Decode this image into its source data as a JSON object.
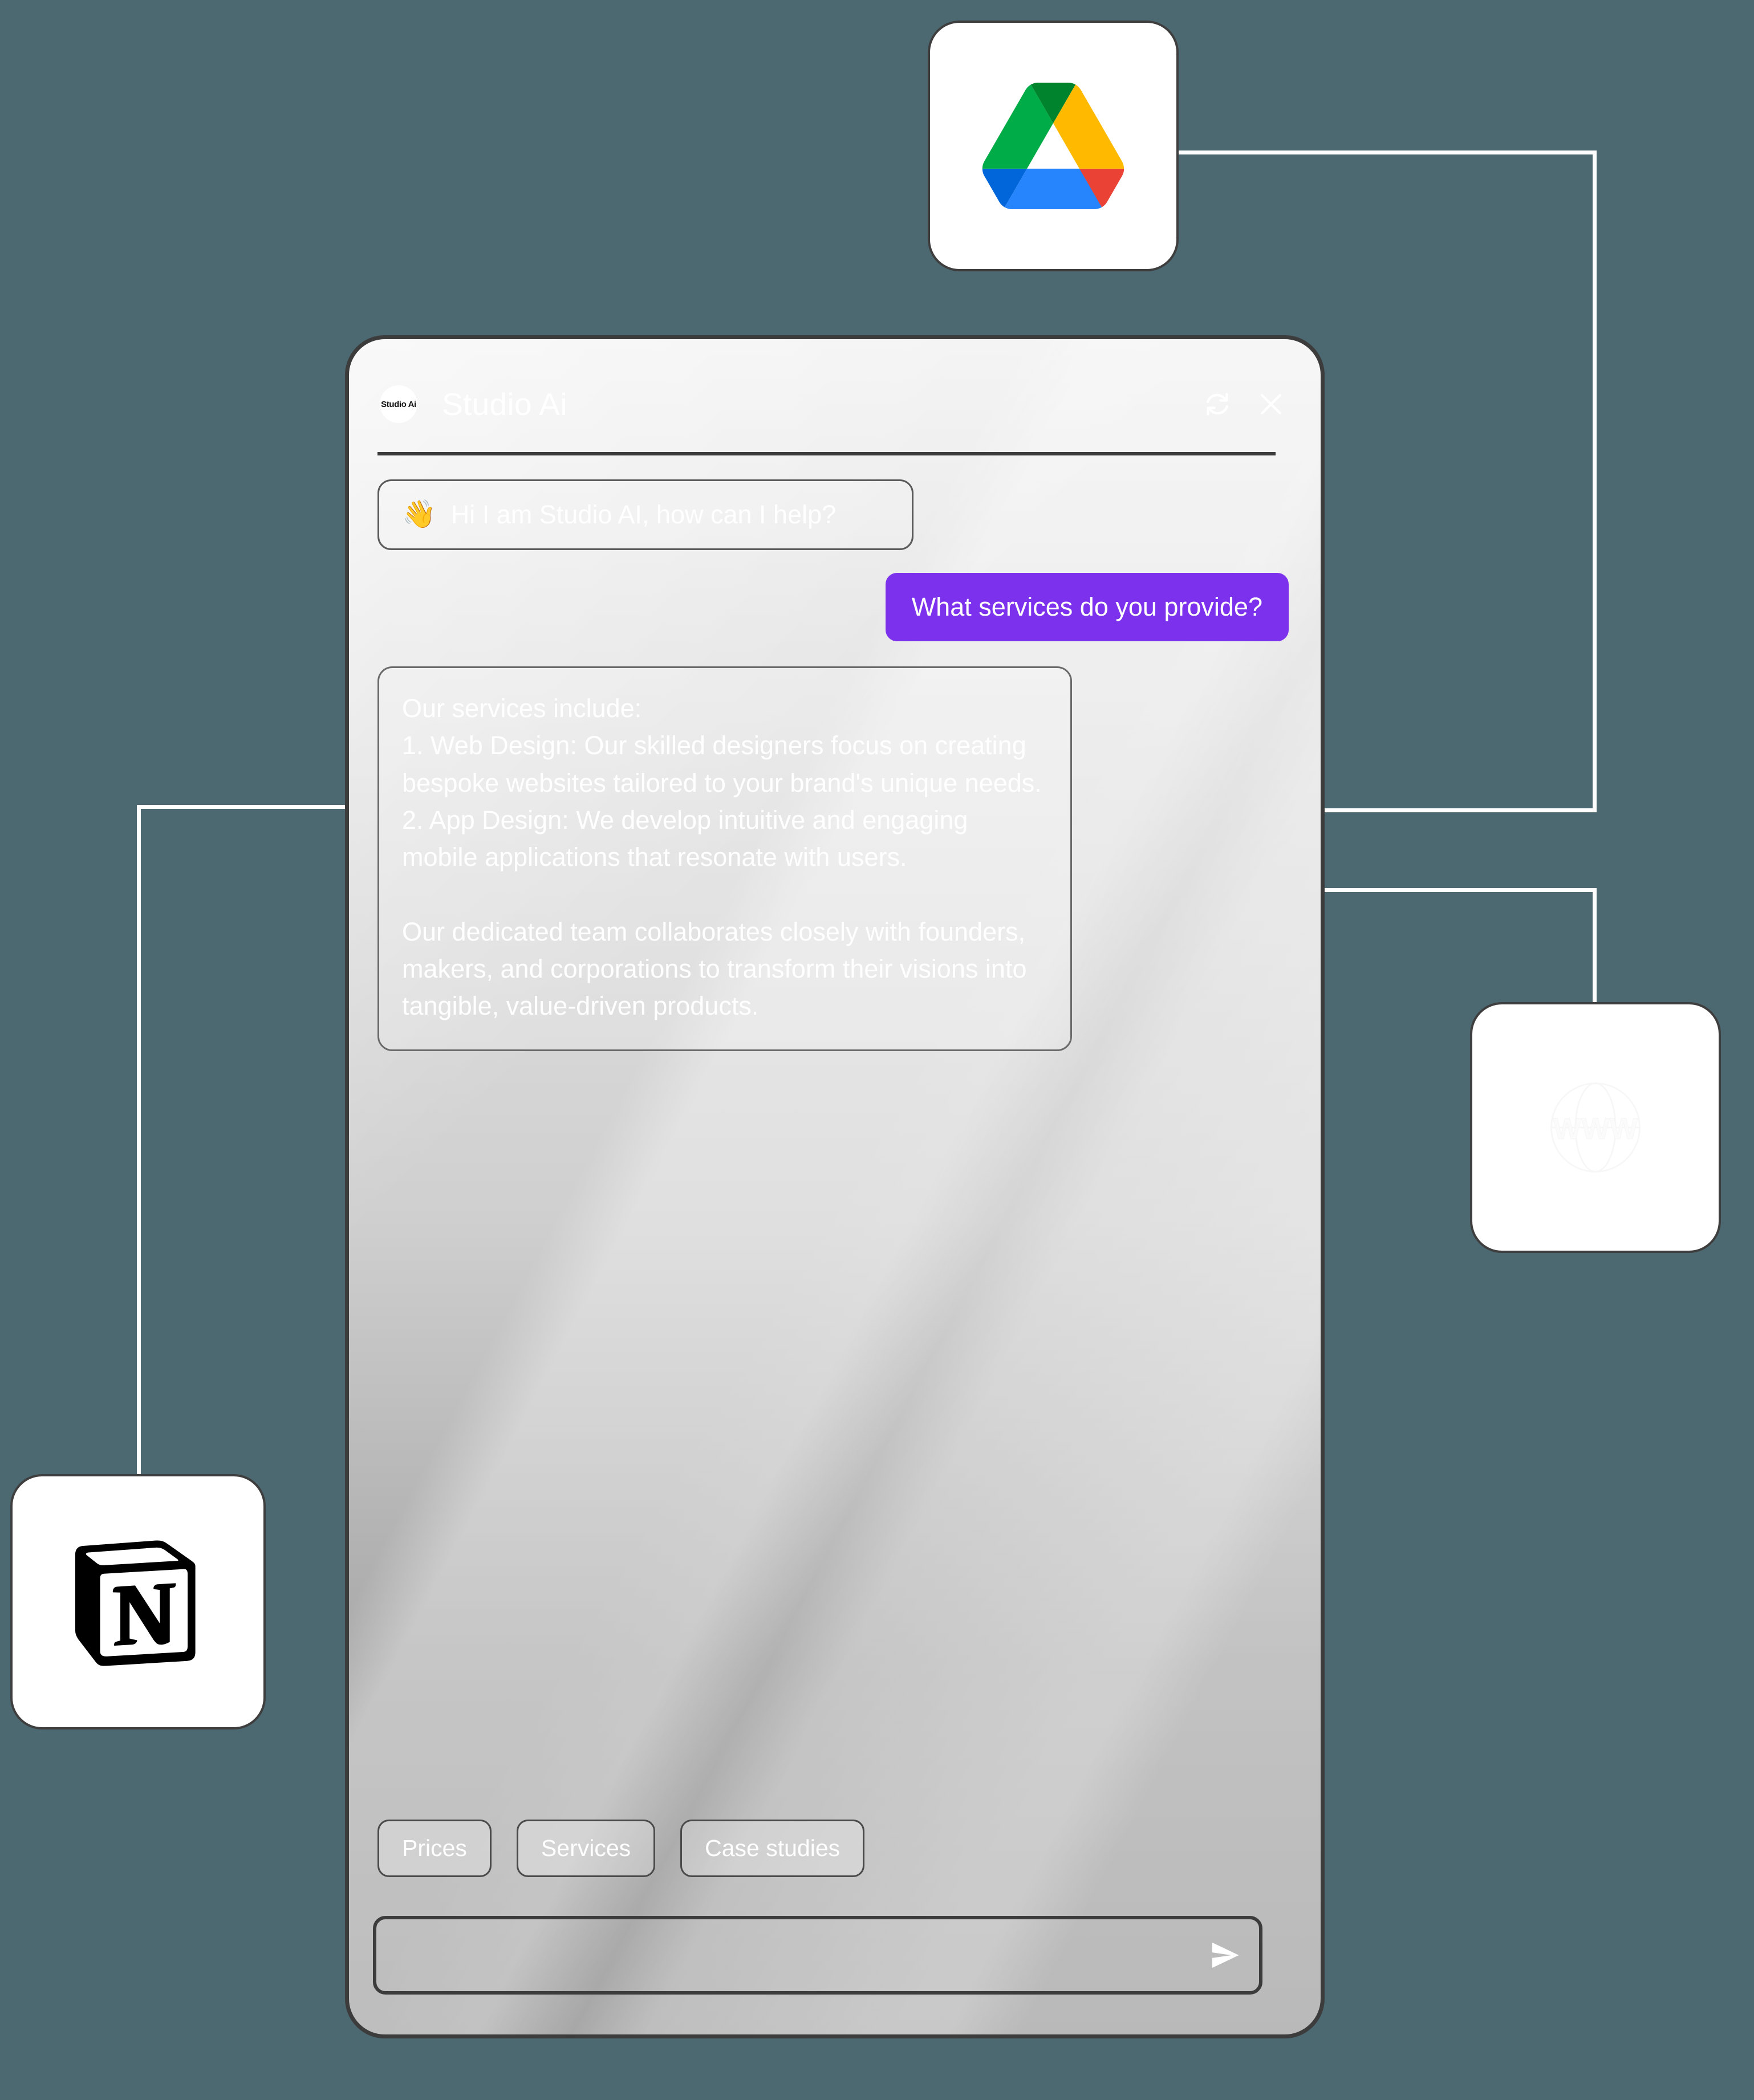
{
  "canvas": {
    "background_color": "#4c6870",
    "connector_color": "#ffffff"
  },
  "integrations": [
    {
      "name": "google-drive",
      "label": "Google Drive",
      "position": "top-center"
    },
    {
      "name": "notion",
      "label": "Notion",
      "position": "bottom-left"
    },
    {
      "name": "website-www",
      "label": "Website",
      "position": "right"
    }
  ],
  "phone": {
    "frame_color": "#3c3c3c",
    "body_gradient_top": "#f2f2f2",
    "body_gradient_bottom": "#9b9b9b"
  },
  "header": {
    "avatar_label": "Studio Ai",
    "title": "Studio Ai",
    "refresh_icon": "refresh-icon",
    "close_icon": "close-icon"
  },
  "messages": {
    "greeting": {
      "emoji": "👋",
      "text": "Hi I am Studio AI, how can I help?",
      "role": "assistant"
    },
    "user": {
      "text": "What services do you provide?",
      "role": "user",
      "bubble_color": "#7c31ec"
    },
    "bot": {
      "role": "assistant",
      "text": "Our services include:\n1. Web Design: Our skilled designers focus on creating bespoke websites tailored to your brand's unique needs.\n2. App Design: We develop intuitive and engaging mobile applications that resonate with users.\n\nOur dedicated team collaborates closely with founders, makers, and corporations to transform their visions into tangible, value-driven products."
    }
  },
  "suggestions": [
    {
      "label": "Prices"
    },
    {
      "label": "Services"
    },
    {
      "label": "Case studies"
    }
  ],
  "composer": {
    "value": "",
    "placeholder": "",
    "send_icon": "send-icon"
  }
}
